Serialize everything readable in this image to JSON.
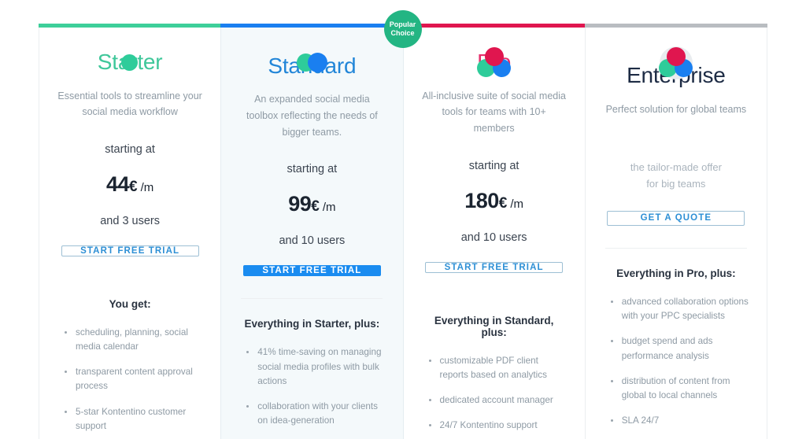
{
  "badge": {
    "line1": "Popular",
    "line2": "Choice",
    "color": "#23b583"
  },
  "plans": [
    {
      "id": "starter",
      "accent_color": "#3ecf9a",
      "title": "Starter",
      "icon": "single-circle-icon",
      "description": "Essential tools to streamline your social media workflow",
      "starting_at": "starting at",
      "price_amount": "44",
      "price_currency": "€",
      "price_period": "/m",
      "users": "and 3 users",
      "cta_label": "START FREE TRIAL",
      "features_title": "You get:",
      "features": [
        "scheduling, planning, social media calendar",
        "transparent content approval process",
        "5-star Kontentino customer support"
      ]
    },
    {
      "id": "standard",
      "accent_color": "#1a7ff0",
      "title": "Standard",
      "icon": "two-circles-icon",
      "description": "An expanded social media toolbox reflecting the needs of bigger teams.",
      "starting_at": "starting at",
      "price_amount": "99",
      "price_currency": "€",
      "price_period": "/m",
      "users": "and 10 users",
      "cta_label": "START FREE TRIAL",
      "features_title": "Everything in Starter, plus:",
      "features": [
        "41% time-saving on managing social media profiles with bulk actions",
        "collaboration with your clients on idea-generation"
      ]
    },
    {
      "id": "pro",
      "accent_color": "#e0164f",
      "title": "Pro",
      "icon": "three-circles-icon",
      "description": "All-inclusive suite of social media tools for teams with 10+ members",
      "starting_at": "starting at",
      "price_amount": "180",
      "price_currency": "€",
      "price_period": "/m",
      "users": "and 10 users",
      "cta_label": "START FREE TRIAL",
      "features_title": "Everything in Standard, plus:",
      "features": [
        "customizable PDF client reports based on analytics",
        "dedicated account manager",
        "24/7 Kontentino support"
      ]
    },
    {
      "id": "enterprise",
      "accent_color": "#b9bdc1",
      "title": "Enterprise",
      "icon": "three-circles-badge-icon",
      "description": "Perfect solution for global teams",
      "offer_line1": "the tailor-made offer",
      "offer_line2": "for big teams",
      "cta_label": "GET A QUOTE",
      "features_title": "Everything in Pro, plus:",
      "features": [
        "advanced collaboration options with your PPC specialists",
        "budget spend and ads performance analysis",
        "distribution of content from global to local channels",
        "SLA 24/7"
      ]
    }
  ]
}
